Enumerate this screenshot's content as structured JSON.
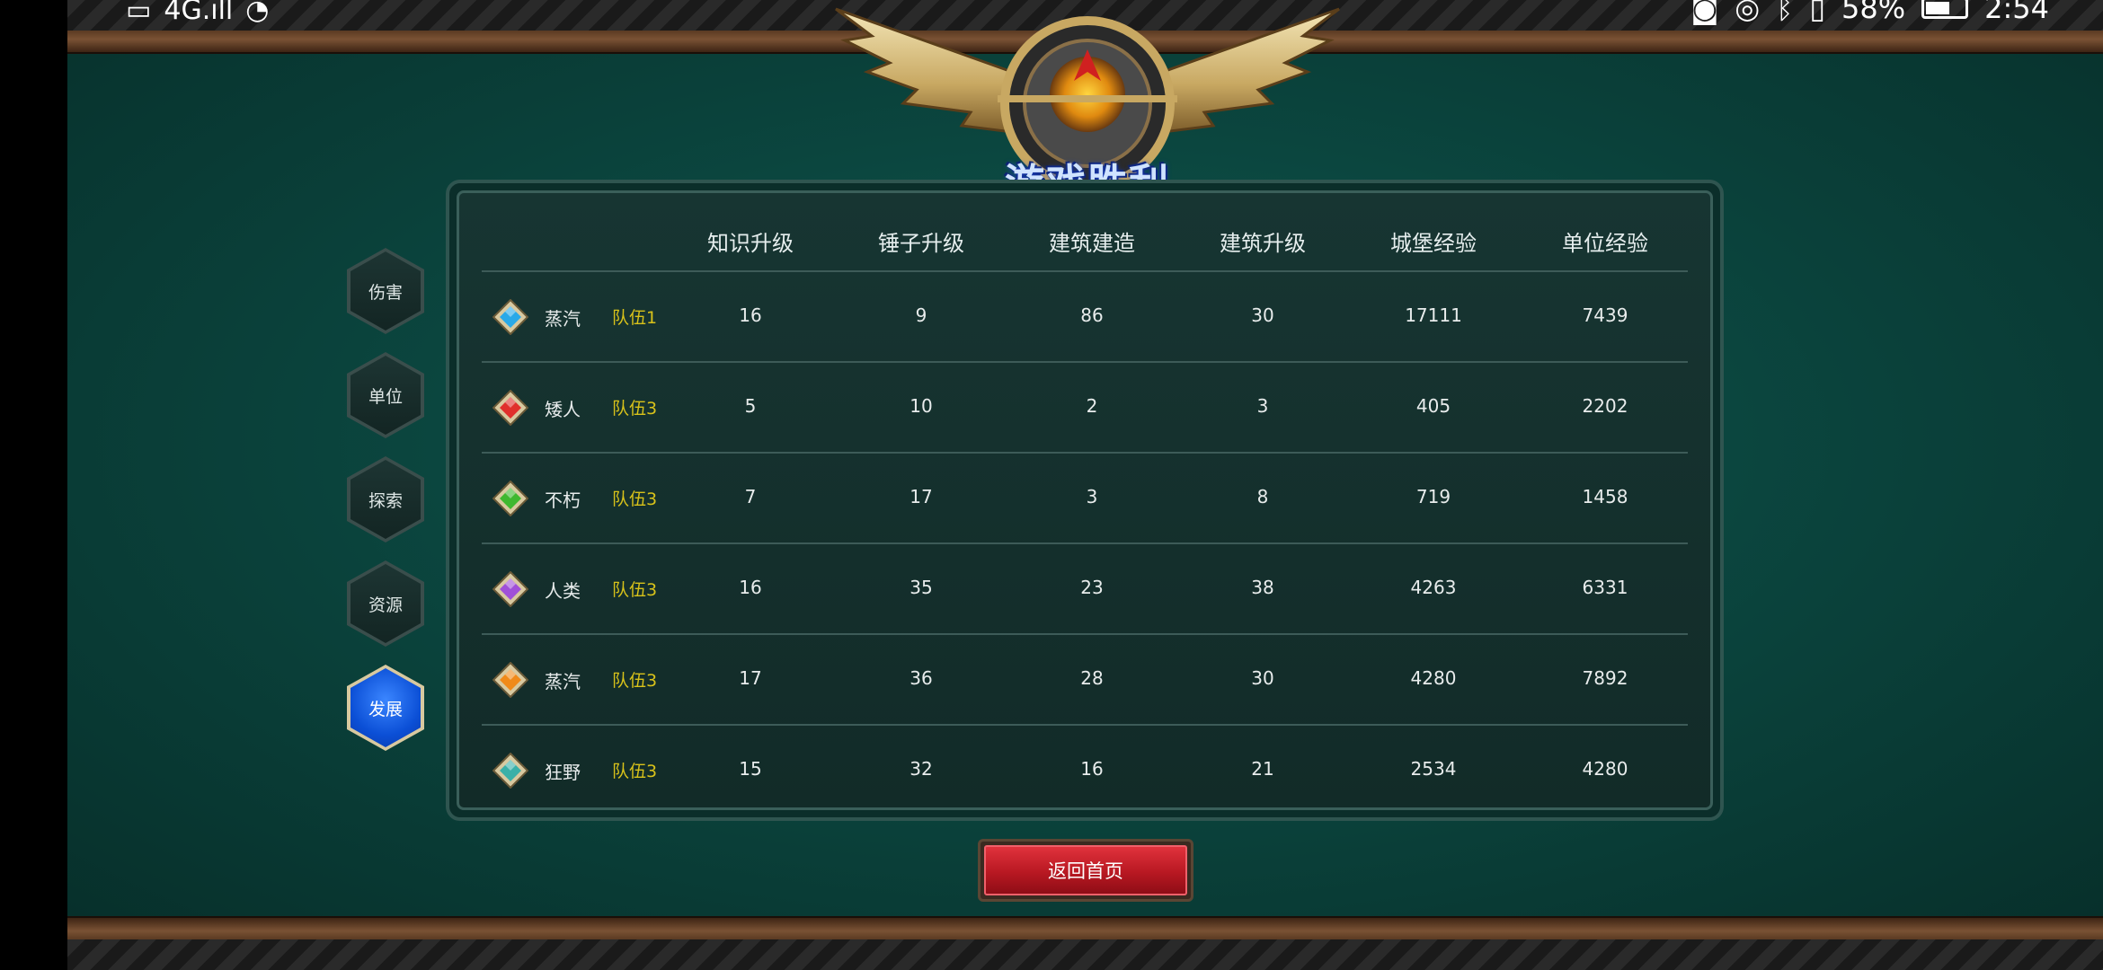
{
  "status_bar": {
    "left_icons": [
      "sim-icon",
      "signal-icon",
      "wechat-icon"
    ],
    "left_text": "4G.ıll",
    "battery_percent": "58%",
    "time": "2:54"
  },
  "header": {
    "title": "游戏胜利"
  },
  "table": {
    "columns": [
      "知识升级",
      "锤子升级",
      "建筑建造",
      "建筑升级",
      "城堡经验",
      "单位经验"
    ],
    "rows": [
      {
        "gem_color": "#29a9e8",
        "race": "蒸汽",
        "team": "队伍1",
        "values": [
          "16",
          "9",
          "86",
          "30",
          "17111",
          "7439"
        ]
      },
      {
        "gem_color": "#e0302c",
        "race": "矮人",
        "team": "队伍3",
        "values": [
          "5",
          "10",
          "2",
          "3",
          "405",
          "2202"
        ]
      },
      {
        "gem_color": "#3fb830",
        "race": "不朽",
        "team": "队伍3",
        "values": [
          "7",
          "17",
          "3",
          "8",
          "719",
          "1458"
        ]
      },
      {
        "gem_color": "#a050d8",
        "race": "人类",
        "team": "队伍3",
        "values": [
          "16",
          "35",
          "23",
          "38",
          "4263",
          "6331"
        ]
      },
      {
        "gem_color": "#f08a1a",
        "race": "蒸汽",
        "team": "队伍3",
        "values": [
          "17",
          "36",
          "28",
          "30",
          "4280",
          "7892"
        ]
      },
      {
        "gem_color": "#3ab0a8",
        "race": "狂野",
        "team": "队伍3",
        "values": [
          "15",
          "32",
          "16",
          "21",
          "2534",
          "4280"
        ]
      }
    ]
  },
  "side_tabs": [
    {
      "label": "伤害",
      "active": false
    },
    {
      "label": "单位",
      "active": false
    },
    {
      "label": "探索",
      "active": false
    },
    {
      "label": "资源",
      "active": false
    },
    {
      "label": "发展",
      "active": true
    }
  ],
  "footer": {
    "return_label": "返回首页"
  }
}
